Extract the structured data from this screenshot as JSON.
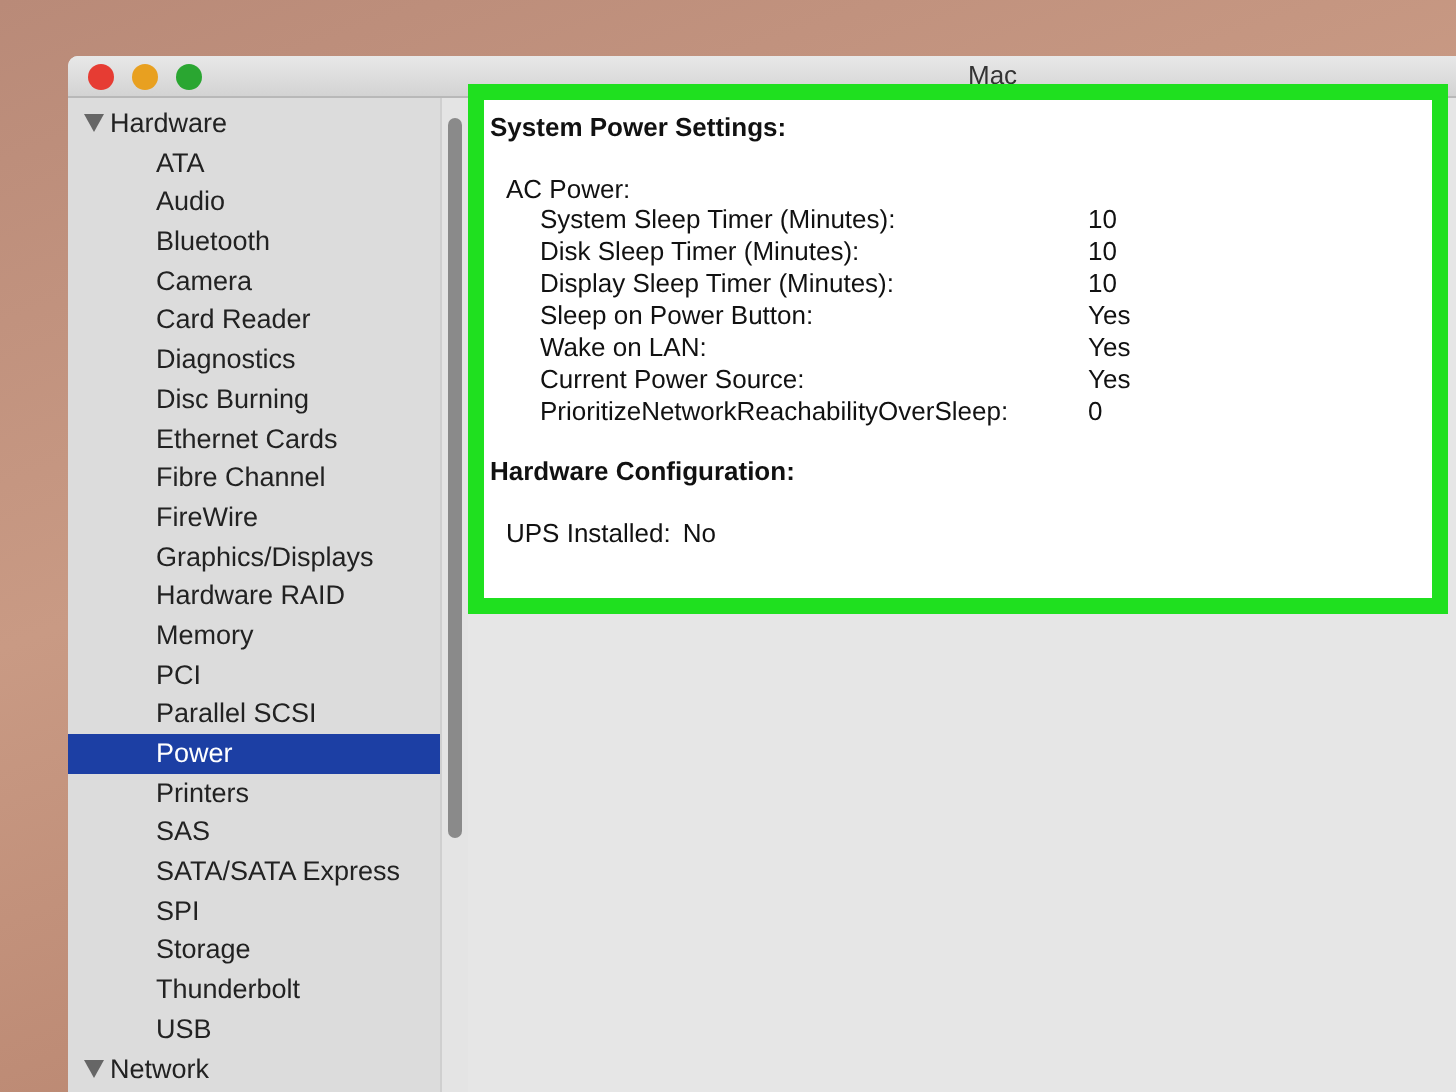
{
  "window": {
    "title": "Mac"
  },
  "sidebar": {
    "groups": [
      {
        "label": "Hardware",
        "expanded": true,
        "items": [
          {
            "label": "ATA",
            "selected": false
          },
          {
            "label": "Audio",
            "selected": false
          },
          {
            "label": "Bluetooth",
            "selected": false
          },
          {
            "label": "Camera",
            "selected": false
          },
          {
            "label": "Card Reader",
            "selected": false
          },
          {
            "label": "Diagnostics",
            "selected": false
          },
          {
            "label": "Disc Burning",
            "selected": false
          },
          {
            "label": "Ethernet Cards",
            "selected": false
          },
          {
            "label": "Fibre Channel",
            "selected": false
          },
          {
            "label": "FireWire",
            "selected": false
          },
          {
            "label": "Graphics/Displays",
            "selected": false
          },
          {
            "label": "Hardware RAID",
            "selected": false
          },
          {
            "label": "Memory",
            "selected": false
          },
          {
            "label": "PCI",
            "selected": false
          },
          {
            "label": "Parallel SCSI",
            "selected": false
          },
          {
            "label": "Power",
            "selected": true
          },
          {
            "label": "Printers",
            "selected": false
          },
          {
            "label": "SAS",
            "selected": false
          },
          {
            "label": "SATA/SATA Express",
            "selected": false
          },
          {
            "label": "SPI",
            "selected": false
          },
          {
            "label": "Storage",
            "selected": false
          },
          {
            "label": "Thunderbolt",
            "selected": false
          },
          {
            "label": "USB",
            "selected": false
          }
        ]
      },
      {
        "label": "Network",
        "expanded": true
      }
    ]
  },
  "report": {
    "sections": [
      {
        "heading": "System Power Settings:",
        "groups": [
          {
            "label": "AC Power:",
            "rows": [
              {
                "name": "System Sleep Timer (Minutes):",
                "value": "10"
              },
              {
                "name": "Disk Sleep Timer (Minutes):",
                "value": "10"
              },
              {
                "name": "Display Sleep Timer (Minutes):",
                "value": "10"
              },
              {
                "name": "Sleep on Power Button:",
                "value": "Yes"
              },
              {
                "name": "Wake on LAN:",
                "value": "Yes"
              },
              {
                "name": "Current Power Source:",
                "value": "Yes"
              },
              {
                "name": "PrioritizeNetworkReachabilityOverSleep:",
                "value": "0"
              }
            ]
          }
        ]
      },
      {
        "heading": "Hardware Configuration:",
        "pairs": [
          {
            "name": "UPS Installed:",
            "value": "No"
          }
        ]
      }
    ]
  }
}
